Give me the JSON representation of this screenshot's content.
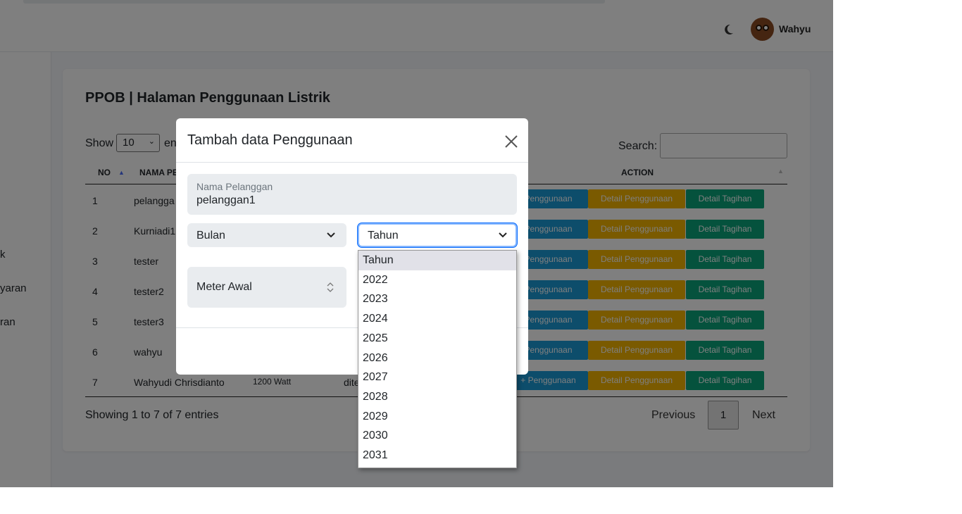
{
  "header": {
    "user_name": "Wahyu",
    "theme_icon": "moon-icon",
    "avatar_icon": "avatar-icon"
  },
  "sidebar": {
    "items": [
      {
        "label": "k"
      },
      {
        "label": "yaran"
      },
      {
        "label": "ran"
      }
    ]
  },
  "page": {
    "title": "PPOB | Halaman Penggunaan Listrik",
    "show_label": "Show",
    "show_value": "10",
    "entries_label": "en",
    "search_label": "Search:",
    "columns": {
      "no": "NO",
      "nama": "NAMA PE",
      "action": "ACTION"
    },
    "rows": [
      {
        "no": "1",
        "nama": "pelangga",
        "daya": "",
        "ket": "",
        "btn1": "Penggunaan",
        "btn2": "Detail Penggunaan",
        "btn3": "Detail Tagihan"
      },
      {
        "no": "2",
        "nama": "Kurniadi1",
        "daya": "",
        "ket": "",
        "btn1": "Penggunaan",
        "btn2": "Detail Penggunaan",
        "btn3": "Detail Tagihan"
      },
      {
        "no": "3",
        "nama": "tester",
        "daya": "",
        "ket": "",
        "btn1": "Penggunaan",
        "btn2": "Detail Penggunaan",
        "btn3": "Detail Tagihan"
      },
      {
        "no": "4",
        "nama": "tester2",
        "daya": "",
        "ket": "",
        "btn1": "Penggunaan",
        "btn2": "Detail Penggunaan",
        "btn3": "Detail Tagihan"
      },
      {
        "no": "5",
        "nama": "tester3",
        "daya": "",
        "ket": "",
        "btn1": "Penggunaan",
        "btn2": "Detail Penggunaan",
        "btn3": "Detail Tagihan"
      },
      {
        "no": "6",
        "nama": "wahyu",
        "daya": "",
        "ket": "",
        "btn1": "Penggunaan",
        "btn2": "Detail Penggunaan",
        "btn3": "Detail Tagihan"
      },
      {
        "no": "7",
        "nama": "Wahyudi Chrisdianto",
        "daya": "1200 Watt",
        "ket": "dite",
        "btn1": "+ Penggunaan",
        "btn2": "Detail Penggunaan",
        "btn3": "Detail Tagihan"
      }
    ],
    "showing_text": "Showing 1 to 7 of 7 entries",
    "pagination": {
      "previous": "Previous",
      "current": "1",
      "next": "Next"
    }
  },
  "modal": {
    "title": "Tambah data Penggunaan",
    "close_icon": "close-icon",
    "nama_pelanggan_label": "Nama Pelanggan",
    "nama_pelanggan_value": "pelanggan1",
    "bulan_value": "Bulan",
    "tahun_value": "Tahun",
    "meter_awal_placeholder": "Meter Awal"
  },
  "tahun_dropdown": {
    "options": [
      "Tahun",
      "2022",
      "2023",
      "2024",
      "2025",
      "2026",
      "2027",
      "2028",
      "2029",
      "2030",
      "2031"
    ],
    "highlighted": "Tahun"
  },
  "colors": {
    "blue_button": "#1a9ad6",
    "yellow_button": "#f4b400",
    "green_button": "#0aa47a",
    "focus_border": "#86b7fe"
  }
}
